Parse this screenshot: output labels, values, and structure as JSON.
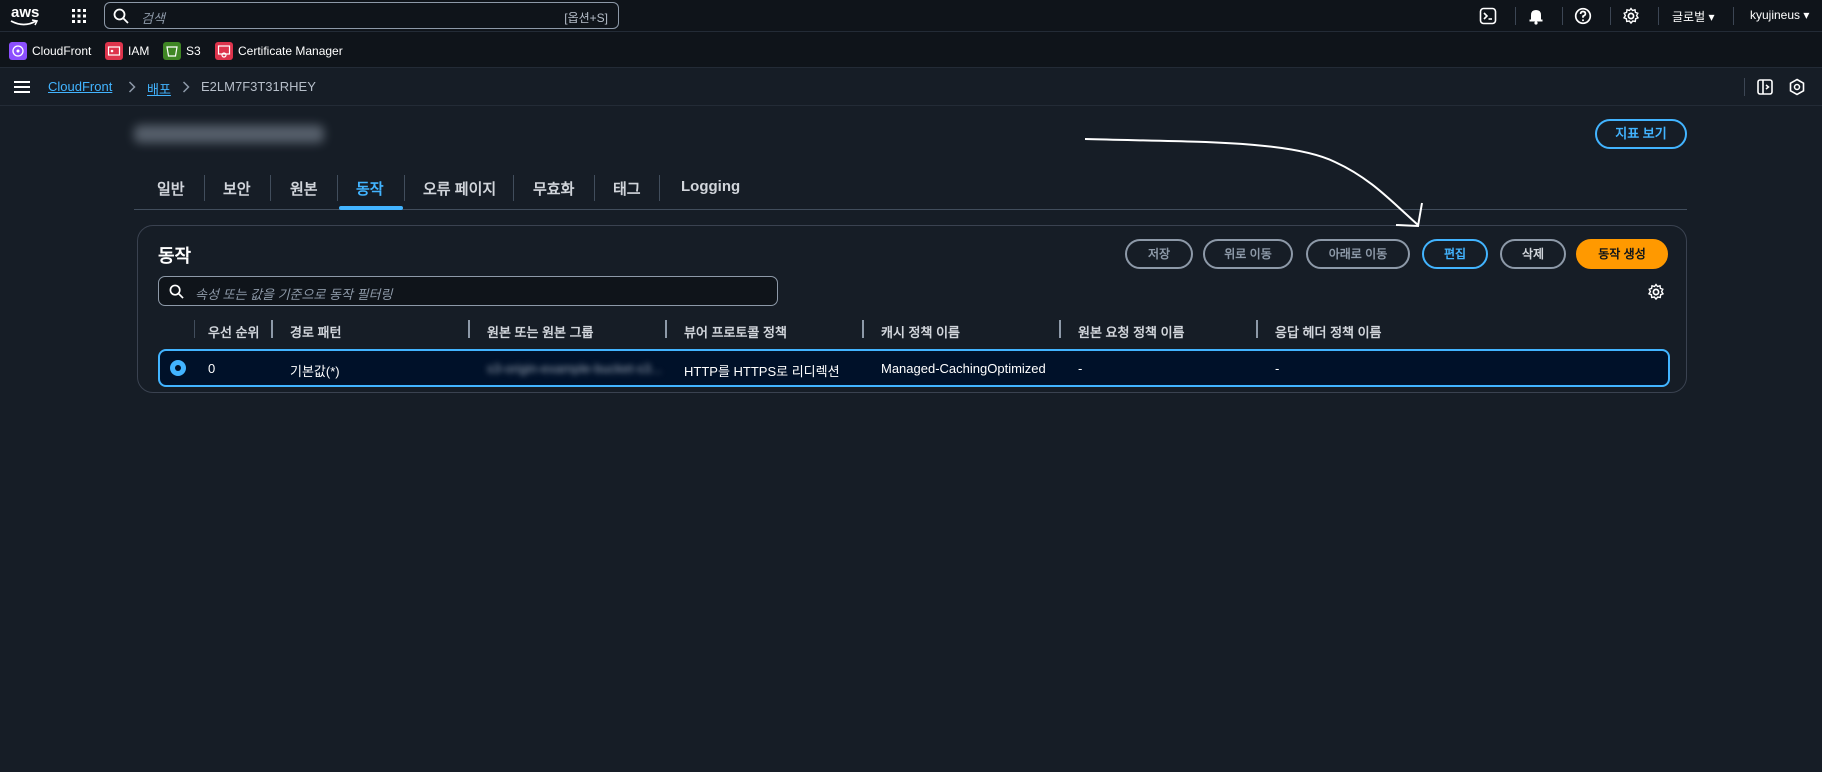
{
  "topnav": {
    "logo": "aws",
    "search_placeholder": "검색",
    "search_shortcut": "[옵션+S]",
    "region": "글로벌 ▾",
    "user": "kyujineus ▾"
  },
  "favorites": [
    {
      "label": "CloudFront",
      "color": "#8c4fff"
    },
    {
      "label": "IAM",
      "color": "#dd344c"
    },
    {
      "label": "S3",
      "color": "#3f8624"
    },
    {
      "label": "Certificate Manager",
      "color": "#dd344c"
    }
  ],
  "breadcrumb": {
    "service": "CloudFront",
    "section": "배포",
    "current": "E2LM7F3T31RHEY"
  },
  "header": {
    "metrics_button": "지표 보기"
  },
  "tabs": [
    "일반",
    "보안",
    "원본",
    "동작",
    "오류 페이지",
    "무효화",
    "태그",
    "Logging"
  ],
  "active_tab": "동작",
  "panel": {
    "title": "동작",
    "buttons": {
      "save": "저장",
      "move_up": "위로 이동",
      "move_down": "아래로 이동",
      "edit": "편집",
      "delete": "삭제",
      "create": "동작 생성"
    },
    "filter_placeholder": "속성 또는 값을 기준으로 동작 필터링"
  },
  "table": {
    "columns": [
      "우선 순위",
      "경로 패턴",
      "원본 또는 원본 그룹",
      "뷰어 프로토콜 정책",
      "캐시 정책 이름",
      "원본 요청 정책 이름",
      "응답 헤더 정책 이름"
    ],
    "rows": [
      {
        "priority": "0",
        "path": "기본값(*)",
        "origin": "s3-origin-example-bucket-s3...",
        "viewer_protocol": "HTTP를 HTTPS로 리디렉션",
        "cache_policy": "Managed-CachingOptimized",
        "origin_request_policy": "-",
        "response_headers_policy": "-"
      }
    ]
  },
  "colors": {
    "background": "#161d26",
    "accent": "#42b4ff",
    "primary_button": "#ff9900"
  }
}
